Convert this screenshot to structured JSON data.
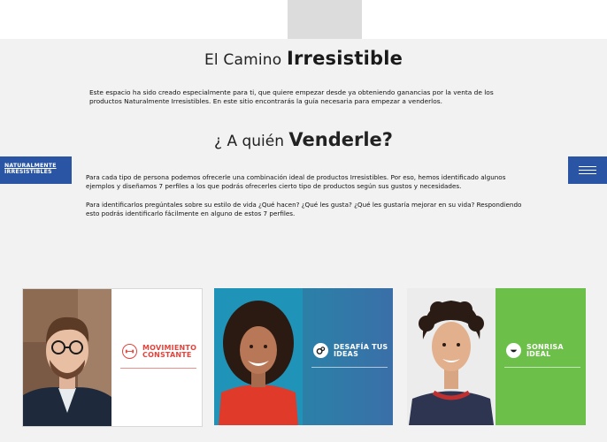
{
  "header": {
    "title_prefix": "El Camino ",
    "title_bold": "Irresistible",
    "intro": "Este espacio ha sido creado especialmente para ti, que quiere empezar desde ya obteniendo ganancias por la venta de los productos Naturalmente Irresistibles. En este sitio encontrarás la guía necesaria para empezar a venderlos."
  },
  "section": {
    "title_prefix": "¿ A quién ",
    "title_bold": "Venderle?",
    "para1": "Para cada tipo de persona podemos ofrecerle una combinación ideal de productos Irresistibles. Por eso, hemos identificado algunos ejemplos y diseñamos 7 perfiles a los que podrás ofrecerles cierto tipo de productos según sus gustos y necesidades.",
    "para2": "Para identificarlos pregúntales sobre su estilo de vida ¿Qué hacen? ¿Qué les gusta? ¿Qué les gustaría mejorar en su vida? Respondiendo esto podrás identificarlo fácilmente en alguno de estos 7 perfiles."
  },
  "logo": {
    "line1": "NATURALMENTE",
    "line2": "IRRESISTIBLES"
  },
  "cards": [
    {
      "line1": "MOVIMIENTO",
      "line2": "CONSTANTE",
      "icon": "dumbbell-icon",
      "color": "#e0453e"
    },
    {
      "line1": "DESAFÍA TUS",
      "line2": "IDEAS",
      "icon": "gears-icon",
      "color": "#2c7fa8"
    },
    {
      "line1": "SONRISA",
      "line2": "IDEAL",
      "icon": "smile-icon",
      "color": "#6cc04a"
    }
  ],
  "colors": {
    "brand": "#2a55a4",
    "background": "#f2f2f2"
  }
}
